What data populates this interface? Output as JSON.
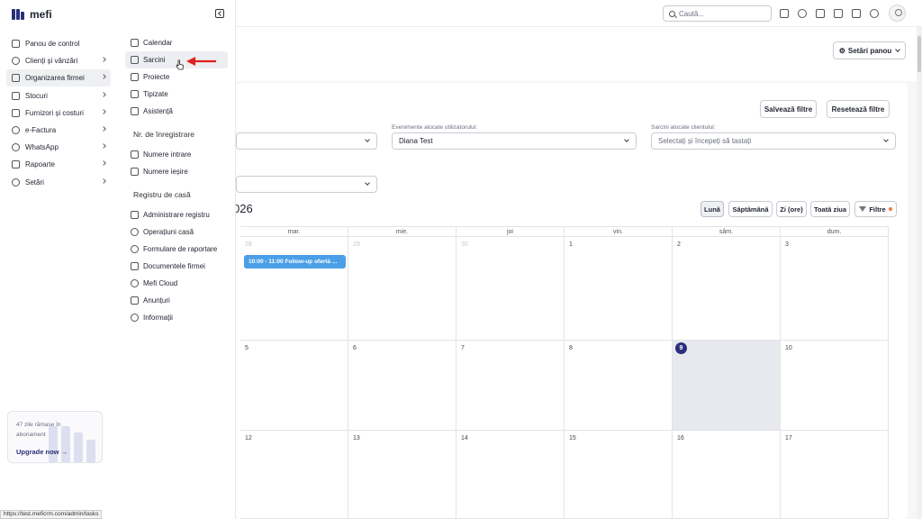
{
  "brand": {
    "name": "mefi"
  },
  "sidebar": {
    "items": [
      {
        "label": "Panou de control"
      },
      {
        "label": "Clienți și vânzări"
      },
      {
        "label": "Organizarea firmei"
      },
      {
        "label": "Stocuri"
      },
      {
        "label": "Furnizori și costuri"
      },
      {
        "label": "e-Factura"
      },
      {
        "label": "WhatsApp"
      },
      {
        "label": "Rapoarte"
      },
      {
        "label": "Setări"
      }
    ],
    "upgrade": {
      "text": "47 zile rămase în abonament",
      "link": "Upgrade now",
      "link_arrow": "→"
    }
  },
  "submenu": {
    "group1": [
      "Calendar",
      "Sarcini",
      "Proiecte",
      "Tipizate",
      "Asistență"
    ],
    "head2": "Nr. de înregistrare",
    "group2": [
      "Numere intrare",
      "Numere ieșire"
    ],
    "head3": "Registru de casă",
    "group3": [
      "Administrare registru",
      "Operațiuni casă",
      "Formulare de raportare",
      "Documentele firmei",
      "Mefi Cloud",
      "Anunțuri",
      "Informații"
    ]
  },
  "header": {
    "search_placeholder": "Caută..."
  },
  "main": {
    "settings_button": "Setări panou",
    "save_filters": "Salvează filtre",
    "reset_filters": "Resetează filtre",
    "filter2_label": "Evenimente alocate utilizatorului:",
    "filter2_value": "Diana Test",
    "filter3_label": "Sarcini alocate clientului:",
    "filter3_placeholder": "Selectați și începeți să tastați",
    "month_title_partial": "026",
    "views": [
      "Lună",
      "Săptămână",
      "Zi (ore)",
      "Toată ziua"
    ],
    "filters_button": "Filtre"
  },
  "calendar": {
    "days": [
      "mar.",
      "mie.",
      "joi",
      "vin.",
      "sâm.",
      "dum."
    ],
    "weeks": [
      [
        {
          "d": "28",
          "muted": true
        },
        {
          "d": "29",
          "muted": true
        },
        {
          "d": "30",
          "muted": true
        },
        {
          "d": "1"
        },
        {
          "d": "2"
        },
        {
          "d": "3"
        }
      ],
      [
        {
          "d": "5"
        },
        {
          "d": "6"
        },
        {
          "d": "7"
        },
        {
          "d": "8"
        },
        {
          "d": "9",
          "today": true
        },
        {
          "d": "10"
        }
      ],
      [
        {
          "d": "12"
        },
        {
          "d": "13"
        },
        {
          "d": "14"
        },
        {
          "d": "15"
        },
        {
          "d": "16"
        },
        {
          "d": "17"
        }
      ]
    ],
    "event": "10:00 - 11:00 Follow-up ofertă ..."
  },
  "statusbar": "https://test.meficrm.com/admin/tasks",
  "colors": {
    "brand": "#2a2f7a",
    "event": "#4a9fe6",
    "arrow": "#e02020",
    "filter_dot": "#f07a3a"
  }
}
